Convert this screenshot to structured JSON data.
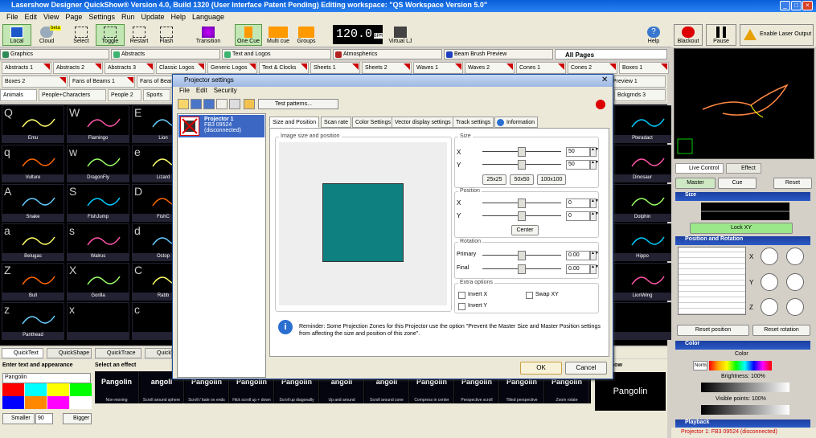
{
  "app": {
    "title": "Lasershow Designer QuickShow®  Version 4.0, Build 1320  (User Interface Patent Pending)  Editing workspace: \"QS Workspace Version 5.0\""
  },
  "menu": [
    "File",
    "Edit",
    "View",
    "Page",
    "Settings",
    "Run",
    "Update",
    "Help",
    "Language"
  ],
  "toolbar": {
    "local": "Local",
    "cloud": "Cloud",
    "cloud_badge": "beta",
    "select": "Select",
    "toggle": "Toggle",
    "restart": "Restart",
    "flash": "Flash",
    "transition": "Transition",
    "one_cue": "One Cue",
    "multi_cue": "Multi cue",
    "groups": "Groups",
    "bpm": "120.0",
    "bpm_unit": "BPM",
    "virtual_lj": "Virtual LJ",
    "help": "Help",
    "blackout": "Blackout",
    "pause": "Pause",
    "enable": "Enable Laser Output"
  },
  "pages": [
    {
      "label": "Graphics",
      "color": "#2e8b57"
    },
    {
      "label": "Abstracts",
      "color": "#2e8b57"
    },
    {
      "label": "Text and Logos",
      "color": "#3cb371"
    },
    {
      "label": "Atmospherics",
      "color": "#b22222"
    },
    {
      "label": "Beam Brush Preview",
      "color": "#1e3fbf"
    },
    {
      "label": "All Pages",
      "color": ""
    }
  ],
  "cat_row1": [
    "Abstracts 1",
    "Abstracts 2",
    "Abstracts 3",
    "Classic Logos",
    "Generic Logos",
    "Text & Clocks",
    "Sheets 1",
    "Sheets 2",
    "Waves 1",
    "Waves 2",
    "Cones 1",
    "Cones 2",
    "Boxes 1"
  ],
  "cat_row2": [
    "Boxes 2",
    "Fans of Beams 1",
    "Fans of Beam",
    "Preview 1"
  ],
  "cat_row3": [
    "Animals",
    "People+Characters",
    "People 2",
    "Sports",
    "Bckgrnds 3"
  ],
  "cues": [
    {
      "key": "Q",
      "name": "Emu"
    },
    {
      "key": "W",
      "name": "Flamingo"
    },
    {
      "key": "E",
      "name": "Lion"
    },
    {
      "key": "",
      "name": "Pteradact"
    },
    {
      "key": "q",
      "name": "Vulture"
    },
    {
      "key": "w",
      "name": "DragonFly"
    },
    {
      "key": "e",
      "name": "Lizard"
    },
    {
      "key": "",
      "name": "Dinosaur"
    },
    {
      "key": "A",
      "name": "Snake"
    },
    {
      "key": "S",
      "name": "FishJump"
    },
    {
      "key": "D",
      "name": "FishC"
    },
    {
      "key": "",
      "name": "Dolphin"
    },
    {
      "key": "a",
      "name": "Belugas"
    },
    {
      "key": "s",
      "name": "Walrus"
    },
    {
      "key": "d",
      "name": "Octop"
    },
    {
      "key": "",
      "name": "Hippo"
    },
    {
      "key": "Z",
      "name": "Bull"
    },
    {
      "key": "X",
      "name": "Gorilla"
    },
    {
      "key": "C",
      "name": "Rabb"
    },
    {
      "key": "",
      "name": "LionWing"
    },
    {
      "key": "z",
      "name": "Panthead"
    },
    {
      "key": "x",
      "name": ""
    },
    {
      "key": "c",
      "name": ""
    },
    {
      "key": "",
      "name": ""
    }
  ],
  "bottom_tabs": [
    "QuickText",
    "QuickShape",
    "QuickTrace",
    "QuickT"
  ],
  "quicktext": {
    "heading": "Enter text and appearance",
    "value": "Pangolin",
    "smaller": "Smaller",
    "size": "90",
    "bigger": "Bigger",
    "effect_heading": "Select an effect",
    "show_now": "ow it now"
  },
  "effects": [
    {
      "text": "Pangolin",
      "label": "Non-moving"
    },
    {
      "text": "angoli",
      "label": "Scroll around sphere"
    },
    {
      "text": "Pangolin",
      "label": "Scroll / fade on ends"
    },
    {
      "text": "Pangolin",
      "label": "Hick scroll up + down"
    },
    {
      "text": "Pangolin",
      "label": "Scroll up diagonally"
    },
    {
      "text": "angoli",
      "label": "Up and around"
    },
    {
      "text": "angoli",
      "label": "Scroll around cone"
    },
    {
      "text": "Pangolin",
      "label": "Compress in center"
    },
    {
      "text": "Pangolin",
      "label": "Perspective scroll"
    },
    {
      "text": "Pangolin",
      "label": "Tilted perspective"
    },
    {
      "text": "Pangolin",
      "label": "Zoom rotate"
    }
  ],
  "preview_text": "Pangolin",
  "right": {
    "live_control": "Live Control",
    "effect": "Effect",
    "master": "Master",
    "cue": "Cue",
    "reset": "Reset",
    "size": "Size",
    "lock_xy": "Lock XY",
    "pos_rot": "Position and Rotation",
    "x": "X",
    "y": "Y",
    "z": "Z",
    "reset_position": "Reset position",
    "reset_rotation": "Reset rotation",
    "color": "Color",
    "color_label": "Color",
    "norm": "Norm.",
    "brightness": "Brightness: 100%",
    "visible_points": "Visible points: 100%",
    "playback": "Playback"
  },
  "status": "Projector 1: FB3 09524 (disconnected)",
  "dialog": {
    "title": "Projector settings",
    "menu": [
      "File",
      "Edit",
      "Security"
    ],
    "test_patterns": "Test patterns...",
    "projector_name": "Projector 1",
    "projector_sub": "FB3 09524 (disconnected)",
    "tabs": [
      "Size and Position",
      "Scan rate",
      "Color Settings",
      "Vector display settings",
      "Track settings",
      "Information"
    ],
    "image_group": "Image size and position",
    "size_group": "Size",
    "size_x": "50",
    "size_y": "50",
    "btn_25": "25x25",
    "btn_50": "50x50",
    "btn_100": "100x100",
    "position_group": "Position",
    "pos_x": "0",
    "pos_y": "0",
    "center": "Center",
    "rotation_group": "Rotation",
    "primary_label": "Primary",
    "primary": "0.00",
    "final_label": "Final",
    "final": "0.00",
    "extra_group": "Extra options",
    "invert_x": "Invert X",
    "invert_y": "Invert Y",
    "swap_xy": "Swap XY",
    "x_label": "X",
    "y_label": "Y",
    "reminder": "Reminder: Some Projection Zones for this Projector use the option \"Prevent the Master Size and Master Position settings from affecting the size and position of this zone\".",
    "ok": "OK",
    "cancel": "Cancel",
    "box_color": "#0f8080"
  }
}
